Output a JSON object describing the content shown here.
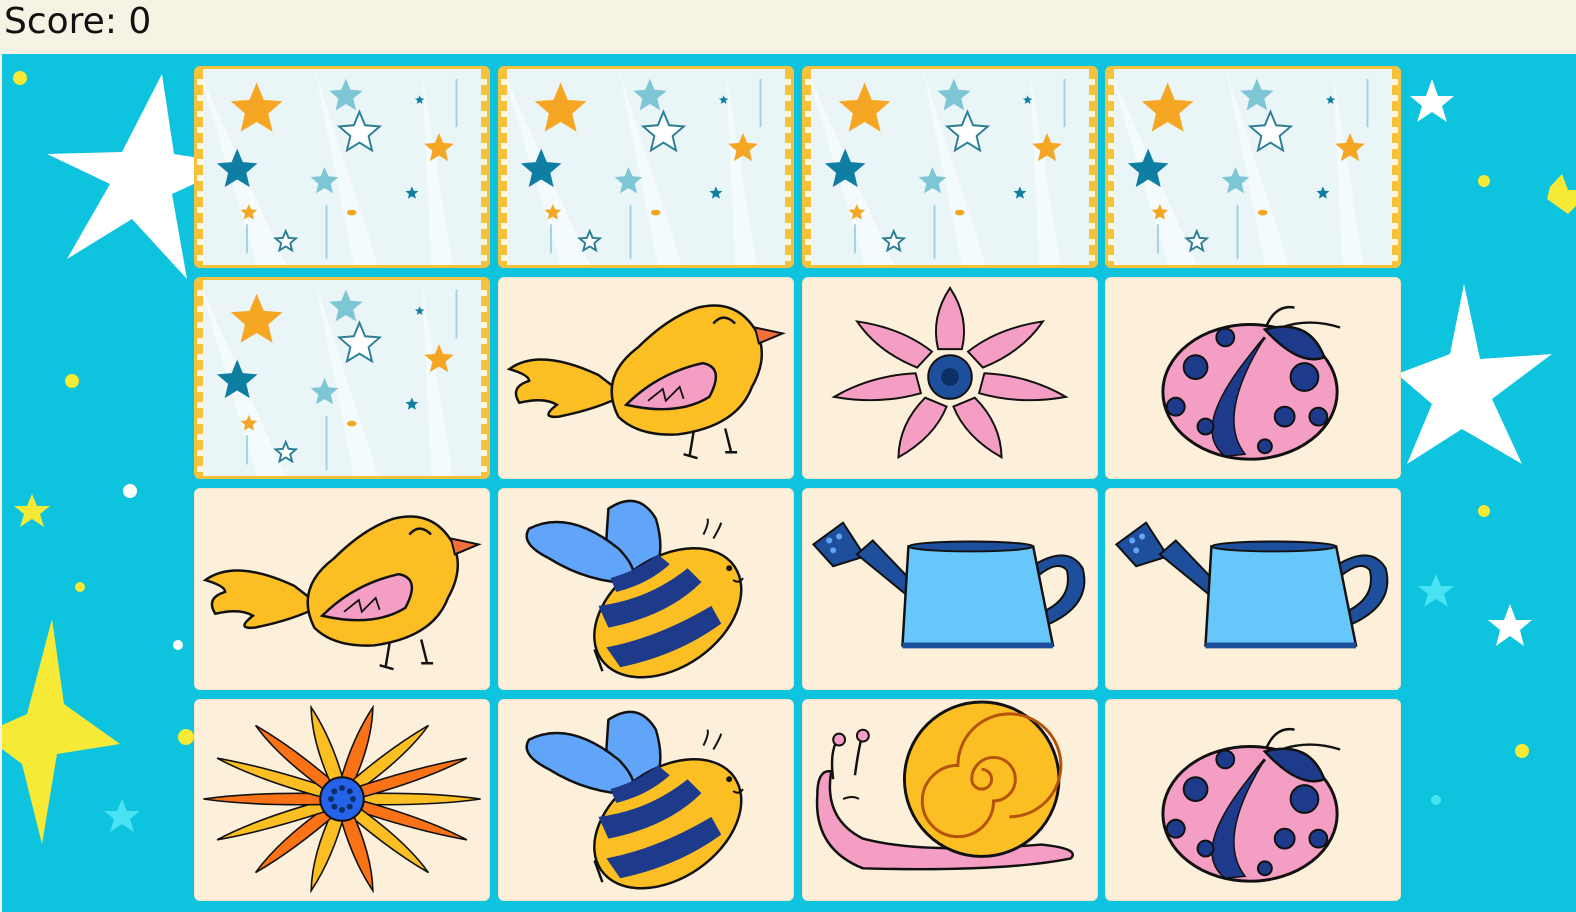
{
  "score_text": "Score: 0",
  "colors": {
    "board": "#0ec3dd",
    "card_face": "#fdf0da",
    "card_back": "#eaf5f7",
    "card_back_border": "#f6c23c"
  },
  "cards": [
    {
      "state": "face-down",
      "icon": "star-pattern-back"
    },
    {
      "state": "face-down",
      "icon": "star-pattern-back"
    },
    {
      "state": "face-down",
      "icon": "star-pattern-back"
    },
    {
      "state": "face-down",
      "icon": "star-pattern-back"
    },
    {
      "state": "face-down",
      "icon": "star-pattern-back"
    },
    {
      "state": "face-up",
      "icon": "bird-icon"
    },
    {
      "state": "face-up",
      "icon": "pink-flower-icon"
    },
    {
      "state": "face-up",
      "icon": "ladybug-icon"
    },
    {
      "state": "face-up",
      "icon": "bird-icon"
    },
    {
      "state": "face-up",
      "icon": "bee-icon"
    },
    {
      "state": "face-up",
      "icon": "watering-can-icon"
    },
    {
      "state": "face-up",
      "icon": "watering-can-icon"
    },
    {
      "state": "face-up",
      "icon": "orange-flower-icon"
    },
    {
      "state": "face-up",
      "icon": "bee-icon"
    },
    {
      "state": "face-up",
      "icon": "snail-icon"
    },
    {
      "state": "face-up",
      "icon": "ladybug-icon"
    }
  ]
}
